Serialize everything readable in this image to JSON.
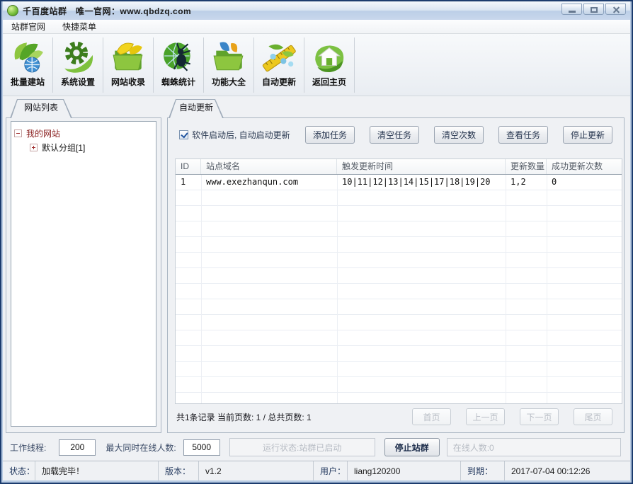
{
  "colors": {
    "window_border": "#1c3c6e",
    "titlebar_blue": "#c8d7ec",
    "accent_navy": "#25344e",
    "tree_root_maroon": "#8b2222",
    "leaf_green": "#7cc142",
    "disabled_grey": "#b7bcc4",
    "checkbox_blue": "#2456a0"
  },
  "window": {
    "title": "千百度站群　唯一官网：www.qbdzq.com"
  },
  "menu": {
    "items": [
      {
        "label": "站群官网"
      },
      {
        "label": "快捷菜单"
      }
    ]
  },
  "toolbar": {
    "items": [
      {
        "label": "批量建站",
        "icon": "globe-leaves-icon"
      },
      {
        "label": "系统设置",
        "icon": "gear-leaf-icon"
      },
      {
        "label": "网站收录",
        "icon": "folder-leaves-icon"
      },
      {
        "label": "蜘蛛统计",
        "icon": "spider-leaf-icon"
      },
      {
        "label": "功能大全",
        "icon": "folder-features-icon"
      },
      {
        "label": "自动更新",
        "icon": "ruler-sprigs-icon"
      },
      {
        "label": "返回主页",
        "icon": "home-leaf-icon"
      }
    ]
  },
  "left_panel": {
    "tab_label": "网站列表",
    "tree": {
      "root_label": "我的网站",
      "child_label": "默认分组[1]"
    }
  },
  "right_panel": {
    "tab_label": "自动更新",
    "autostart_checkbox_label": "软件启动后, 自动启动更新",
    "checkbox_checked": true,
    "task_buttons": [
      {
        "label": "添加任务"
      },
      {
        "label": "清空任务"
      },
      {
        "label": "清空次数"
      },
      {
        "label": "查看任务"
      },
      {
        "label": "停止更新"
      }
    ],
    "table": {
      "columns": [
        {
          "label": "ID"
        },
        {
          "label": "站点域名"
        },
        {
          "label": "触发更新时间"
        },
        {
          "label": "更新数量"
        },
        {
          "label": "成功更新次数"
        }
      ],
      "rows": [
        {
          "id": "1",
          "domain": "www.exezhanqun.com",
          "trigger_times": "10|11|12|13|14|15|17|18|19|20",
          "update_count": "1,2",
          "success_count": "0"
        }
      ]
    },
    "record_summary": "共1条记录 当前页数: 1 / 总共页数: 1",
    "pagination": [
      {
        "label": "首页"
      },
      {
        "label": "上一页"
      },
      {
        "label": "下一页"
      },
      {
        "label": "尾页"
      }
    ]
  },
  "bottom_bar": {
    "worker_threads_label": "工作线程:",
    "worker_threads_value": "200",
    "max_online_label": "最大同时在线人数:",
    "max_online_value": "5000",
    "run_status_button_label": "运行状态:站群已启动",
    "stop_button_label": "停止站群",
    "online_count_text": "在线人数:0"
  },
  "status_bar": {
    "status_label": "状态：",
    "status_value": "加载完毕！",
    "version_label": "版本：",
    "version_value": "v1.2",
    "user_label": "用户：",
    "user_value": "liang120200",
    "expiry_label": "到期：",
    "expiry_value": "2017-07-04 00:12:26"
  }
}
